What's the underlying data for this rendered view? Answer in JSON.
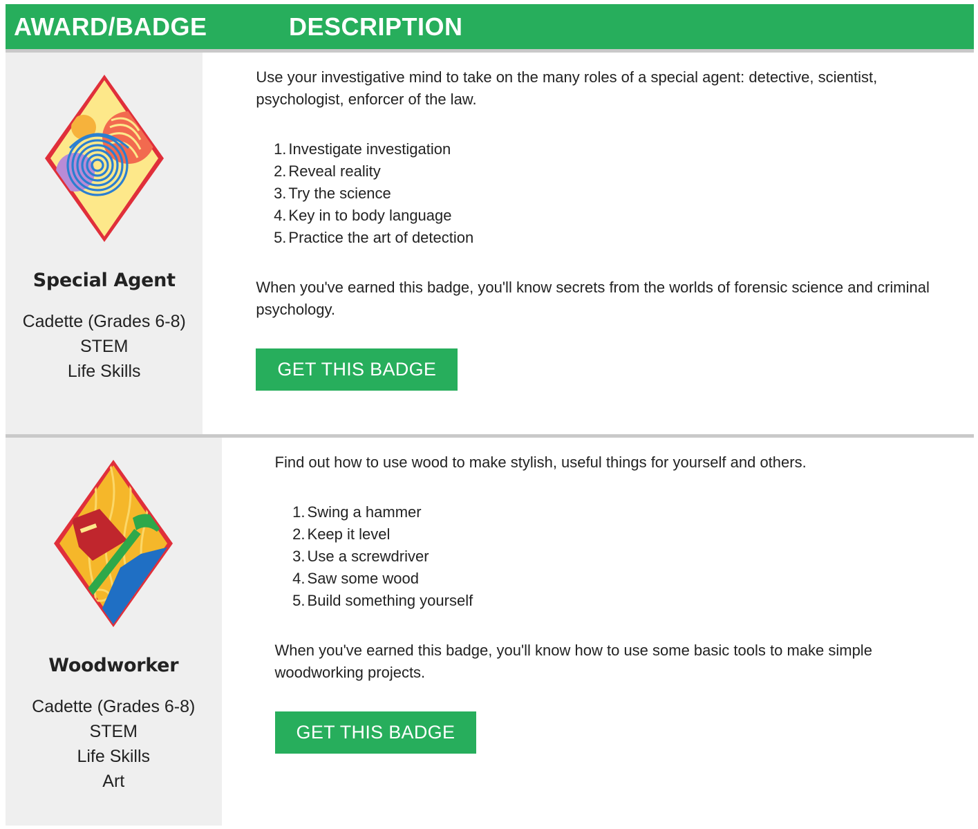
{
  "header": {
    "award_label": "AWARD/BADGE",
    "description_label": "DESCRIPTION"
  },
  "colors": {
    "brand_green": "#27ae5c",
    "left_panel_bg": "#efefef",
    "divider": "#c9c9c9"
  },
  "badges": [
    {
      "name": "Special Agent",
      "icon": "fingerprint-badge-icon",
      "meta": [
        "Cadette (Grades 6-8)",
        "STEM",
        "Life Skills"
      ],
      "intro": "Use your investigative mind to take on the many roles of a special agent: detective, scientist, psychologist, enforcer of the law.",
      "steps": [
        {
          "num": "1.",
          "text": "Investigate investigation"
        },
        {
          "num": "2.",
          "text": "Reveal reality"
        },
        {
          "num": "3.",
          "text": "Try the science"
        },
        {
          "num": "4.",
          "text": "Key in to body language"
        },
        {
          "num": "5.",
          "text": "Practice the art of detection"
        }
      ],
      "outro": "When you've earned this badge, you'll know secrets from the worlds of forensic science and criminal psychology.",
      "button_label": "GET THIS BADGE"
    },
    {
      "name": "Woodworker",
      "icon": "hammer-saw-badge-icon",
      "meta": [
        "Cadette (Grades 6-8)",
        "STEM",
        "Life Skills",
        "Art"
      ],
      "intro": "Find out how to use wood to make stylish, useful things for yourself and others.",
      "steps": [
        {
          "num": "1.",
          "text": "Swing a hammer"
        },
        {
          "num": "2.",
          "text": "Keep it level"
        },
        {
          "num": "3.",
          "text": "Use a screwdriver"
        },
        {
          "num": "4.",
          "text": "Saw some wood"
        },
        {
          "num": "5.",
          "text": "Build something yourself"
        }
      ],
      "outro": "When you've earned this badge, you'll know how to use some basic tools to make simple woodworking projects.",
      "button_label": "GET THIS BADGE"
    }
  ]
}
